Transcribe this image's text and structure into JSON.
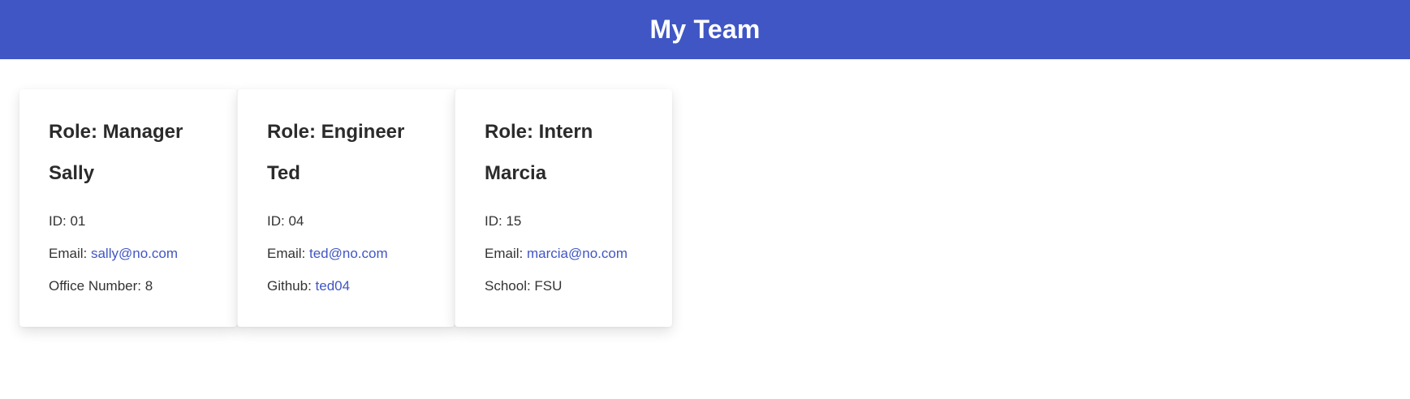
{
  "header": {
    "title": "My Team"
  },
  "colors": {
    "header_bg": "#4056c5",
    "link": "#4056c5"
  },
  "cards": [
    {
      "role": "Role: Manager",
      "name": "Sally",
      "id": "ID: 01",
      "email_label": "Email: ",
      "email": "sally@no.com",
      "extra_label": "Office Number: 8",
      "extra_link": ""
    },
    {
      "role": "Role: Engineer",
      "name": "Ted",
      "id": "ID: 04",
      "email_label": "Email: ",
      "email": "ted@no.com",
      "extra_label": "Github: ",
      "extra_link": "ted04"
    },
    {
      "role": "Role: Intern",
      "name": "Marcia",
      "id": "ID: 15",
      "email_label": "Email: ",
      "email": "marcia@no.com",
      "extra_label": "School: FSU",
      "extra_link": ""
    }
  ]
}
